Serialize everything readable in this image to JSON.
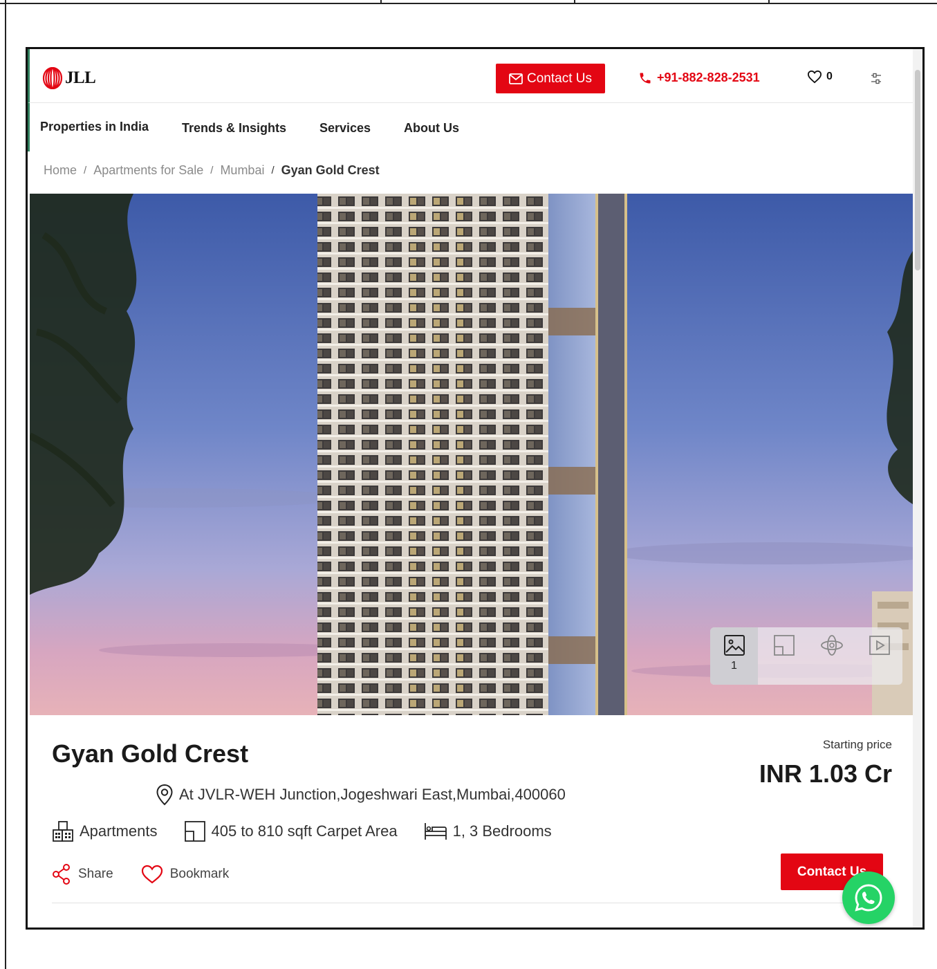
{
  "header": {
    "logo_text": "JLL",
    "contact_label": "Contact Us",
    "phone": "+91-882-828-2531",
    "wishlist_count": "0"
  },
  "nav": {
    "items": [
      {
        "label": "Properties in India"
      },
      {
        "label": "Trends & Insights"
      },
      {
        "label": "Services"
      },
      {
        "label": "About Us"
      }
    ]
  },
  "breadcrumb": {
    "items": [
      "Home",
      "Apartments for Sale",
      "Mumbai"
    ],
    "current": "Gyan Gold Crest",
    "separator": "/"
  },
  "gallery": {
    "image_count": "1",
    "media_types": [
      "photos-icon",
      "floor-plan-icon",
      "360-view-icon",
      "video-icon"
    ]
  },
  "property": {
    "name": "Gyan Gold Crest",
    "starting_price_label": "Starting price",
    "price": "INR 1.03 Cr",
    "address": "At JVLR-WEH Junction,Jogeshwari East,Mumbai,400060",
    "type": "Apartments",
    "area": "405 to 810 sqft Carpet Area",
    "bedrooms": "1, 3 Bedrooms",
    "share_label": "Share",
    "bookmark_label": "Bookmark",
    "contact_label": "Contact Us"
  },
  "colors": {
    "brand_red": "#e30613",
    "whatsapp_green": "#25d366"
  }
}
